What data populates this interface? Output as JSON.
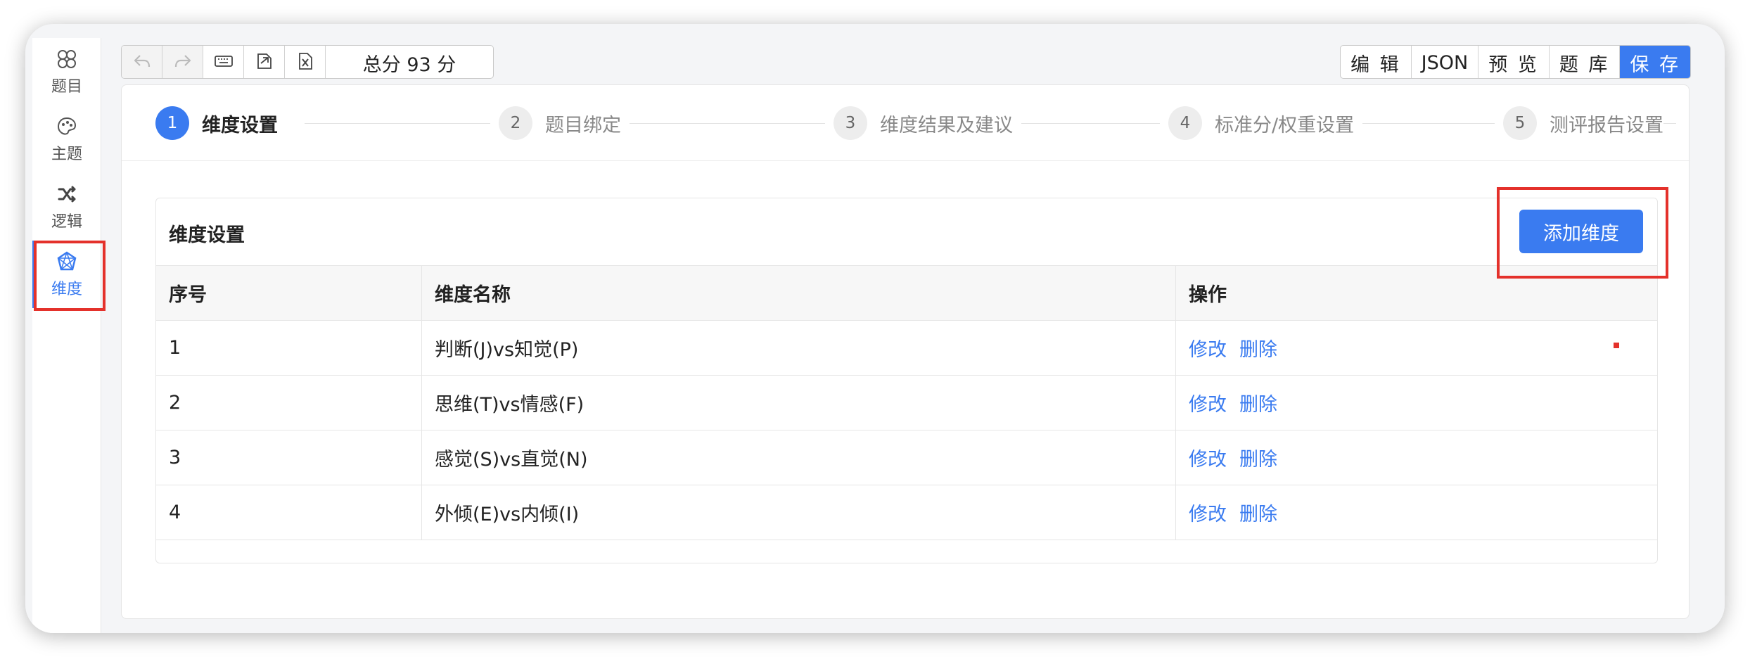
{
  "sidebar": {
    "items": [
      {
        "label": "题目",
        "icon": "questions-icon"
      },
      {
        "label": "主题",
        "icon": "palette-icon"
      },
      {
        "label": "逻辑",
        "icon": "shuffle-icon"
      },
      {
        "label": "维度",
        "icon": "dimension-icon",
        "active": true
      }
    ]
  },
  "toolbar": {
    "undo_icon": "undo-icon",
    "redo_icon": "redo-icon",
    "keyboard_icon": "keyboard-icon",
    "import_icon": "import-icon",
    "excel_icon": "excel-icon",
    "total_score": "总分 93 分",
    "right_buttons": [
      "编 辑",
      "JSON",
      "预 览",
      "题 库",
      "保 存"
    ]
  },
  "steps": [
    {
      "num": "1",
      "label": "维度设置",
      "active": true
    },
    {
      "num": "2",
      "label": "题目绑定"
    },
    {
      "num": "3",
      "label": "维度结果及建议"
    },
    {
      "num": "4",
      "label": "标准分/权重设置"
    },
    {
      "num": "5",
      "label": "测评报告设置"
    }
  ],
  "dimension_panel": {
    "title": "维度设置",
    "add_button": "添加维度",
    "columns": [
      "序号",
      "维度名称",
      "操作"
    ],
    "rows": [
      {
        "index": "1",
        "name": "判断(J)vs知觉(P)",
        "edit": "修改",
        "delete": "删除"
      },
      {
        "index": "2",
        "name": "思维(T)vs情感(F)",
        "edit": "修改",
        "delete": "删除"
      },
      {
        "index": "3",
        "name": "感觉(S)vs直觉(N)",
        "edit": "修改",
        "delete": "删除"
      },
      {
        "index": "4",
        "name": "外倾(E)vs内倾(I)",
        "edit": "修改",
        "delete": "删除"
      }
    ]
  },
  "colors": {
    "accent": "#3a7bf0",
    "highlight": "#e4312b"
  }
}
